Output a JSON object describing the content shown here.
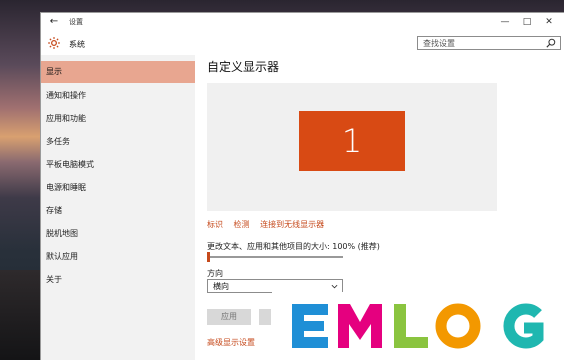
{
  "window": {
    "title": "设置",
    "controls": {
      "minimize": "—",
      "maximize": "□",
      "close": "✕"
    }
  },
  "header": {
    "section": "系统",
    "search_placeholder": "查找设置"
  },
  "sidebar": {
    "items": [
      {
        "label": "显示",
        "active": true
      },
      {
        "label": "通知和操作"
      },
      {
        "label": "应用和功能"
      },
      {
        "label": "多任务"
      },
      {
        "label": "平板电脑模式"
      },
      {
        "label": "电源和睡眠"
      },
      {
        "label": "存储"
      },
      {
        "label": "脱机地图"
      },
      {
        "label": "默认应用"
      },
      {
        "label": "关于"
      }
    ]
  },
  "main": {
    "title": "自定义显示器",
    "monitor_number": "1",
    "links": [
      "标识",
      "检测",
      "连接到无线显示器"
    ],
    "scale_label": "更改文本、应用和其他项目的大小: 100% (推荐)",
    "scale_percent": 100,
    "orientation_label": "方向",
    "orientation_value": "横向",
    "apply_label": "应用",
    "advanced_link": "高级显示设置"
  },
  "watermark": {
    "text": "EMLOG",
    "colors": [
      "#1f8fd6",
      "#e5007f",
      "#8ac43f",
      "#f39800",
      "#1fb7b0"
    ]
  },
  "colors": {
    "accent": "#c64a1c",
    "monitor": "#d84a14",
    "active_nav": "#e8a690"
  }
}
